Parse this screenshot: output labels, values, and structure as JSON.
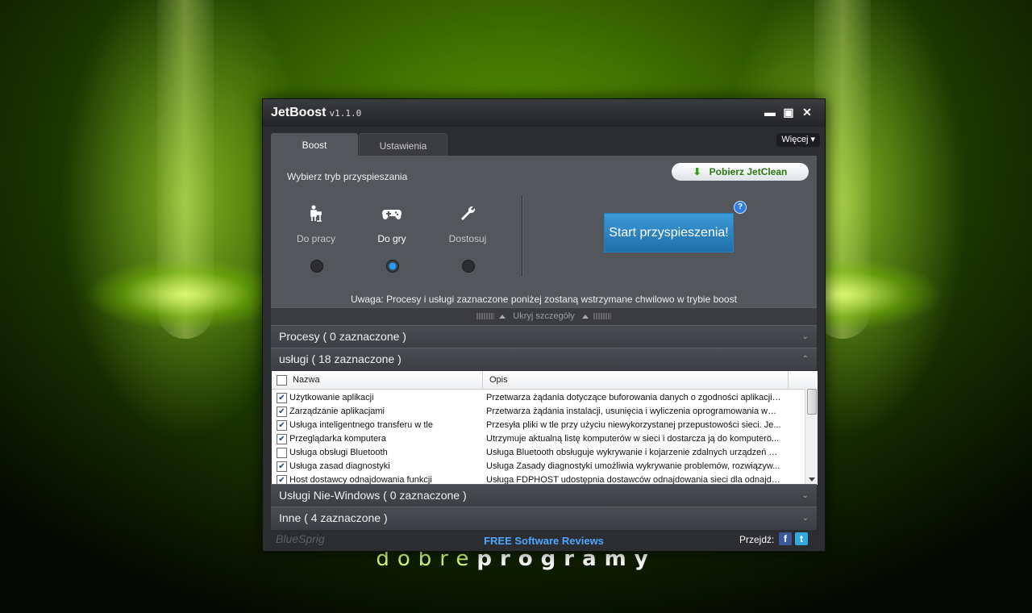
{
  "wallpaper": {
    "logo_light": "dobre",
    "logo_bold": "programy"
  },
  "window": {
    "title": "JetBoost",
    "version": "v1.1.0",
    "controls": {
      "minimize": "▬",
      "maximize": "▣",
      "close": "✕"
    }
  },
  "tabs": [
    {
      "label": "Boost"
    },
    {
      "label": "Ustawienia"
    }
  ],
  "more_button": "Więcej",
  "boost": {
    "mode_label": "Wybierz tryb przyspieszania",
    "modes": [
      {
        "label": "Do pracy",
        "icon": "worker-icon",
        "selected": false
      },
      {
        "label": "Do gry",
        "icon": "gamepad-icon",
        "selected": true
      },
      {
        "label": "Dostosuj",
        "icon": "wrench-icon",
        "selected": false
      }
    ],
    "jetclean_button": "Pobierz JetClean",
    "start_button": "Start przyspieszenia!",
    "help_icon": "?",
    "notice": "Uwaga: Procesy i usługi zaznaczone poniżej zostaną wstrzymane chwilowo w trybie boost",
    "hide_details": "Ukryj szczegóły"
  },
  "sections": [
    {
      "title": "Procesy ( 0 zaznaczone )",
      "expanded": false
    },
    {
      "title": "usługi ( 18 zaznaczone )",
      "expanded": true
    },
    {
      "title": "Usługi Nie-Windows ( 0 zaznaczone )",
      "expanded": false
    },
    {
      "title": "Inne ( 4 zaznaczone )",
      "expanded": false
    }
  ],
  "services_table": {
    "columns": [
      "Nazwa",
      "Opis"
    ],
    "rows": [
      {
        "checked": true,
        "name": "Użytkowanie aplikacji",
        "desc": "Przetwarza żądania dotyczące buforowania danych o zgodności aplikacji ..."
      },
      {
        "checked": true,
        "name": "Zarządzanie aplikacjami",
        "desc": "Przetwarza żądania instalacji, usunięcia i wyliczenia oprogramowania wdr..."
      },
      {
        "checked": true,
        "name": "Usługa inteligentnego transferu w tle",
        "desc": "Przesyła pliki w tle przy użyciu niewykorzystanej przepustowości sieci. Je..."
      },
      {
        "checked": true,
        "name": "Przeglądarka komputera",
        "desc": "Utrzymuje aktualną listę komputerów w sieci i dostarcza ją do komputerö..."
      },
      {
        "checked": false,
        "name": "Usługa obsługi Bluetooth",
        "desc": "Usługa Bluetooth obsługuje wykrywanie i kojarzenie zdalnych urządzeń Bl..."
      },
      {
        "checked": true,
        "name": "Usługa zasad diagnostyki",
        "desc": "Usługa Zasady diagnostyki umożliwia wykrywanie problemów, rozwiązyw..."
      },
      {
        "checked": true,
        "name": "Host dostawcy odnajdowania funkcji",
        "desc": "Usługa FDPHOST udostępnia dostawców odnajdowania sieci dla odnajdo..."
      }
    ]
  },
  "footer": {
    "brand": "BlueSprig",
    "link": "FREE Software Reviews",
    "goto_label": "Przejdź:",
    "facebook": "f",
    "twitter": "t"
  },
  "colors": {
    "accent": "#2a9bff",
    "start_button": "#2a85c4",
    "jetclean_text": "#2a7a10",
    "link": "#4fa6ff"
  }
}
